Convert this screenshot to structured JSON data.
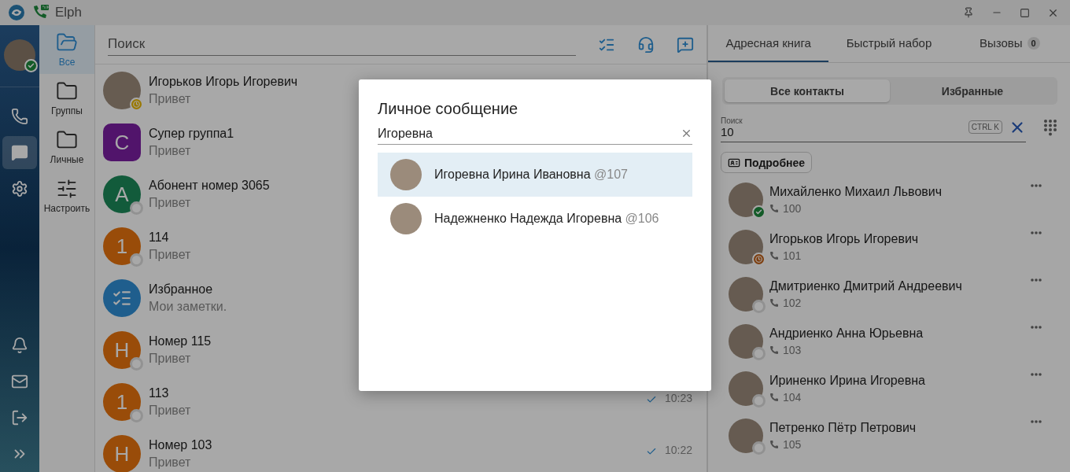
{
  "titlebar": {
    "app_name": "Elph"
  },
  "nav": {
    "user_badge": {
      "kind": "online"
    },
    "top_items": [
      {
        "kind": "phone",
        "selected": false
      },
      {
        "kind": "chat",
        "selected": true
      },
      {
        "kind": "settings",
        "selected": false
      }
    ],
    "bottom_items": [
      {
        "kind": "bell",
        "selected": false
      },
      {
        "kind": "mail",
        "selected": false
      },
      {
        "kind": "logout",
        "selected": false
      },
      {
        "kind": "expand",
        "selected": false
      }
    ]
  },
  "folders": [
    {
      "kind": "all",
      "label": "Все",
      "selected": true
    },
    {
      "kind": "folder",
      "label": "Группы",
      "selected": false
    },
    {
      "kind": "folder",
      "label": "Личные",
      "selected": false
    },
    {
      "kind": "settings",
      "label": "Настроить",
      "selected": false
    }
  ],
  "chat_list": {
    "search": {
      "placeholder": "Поиск"
    },
    "chats": [
      {
        "name": "Игорьков Игорь Игоревич",
        "preview": "Привет",
        "avatar": {
          "kind": "photo"
        },
        "badge": {
          "kind": "away"
        }
      },
      {
        "name": "Супер группа1",
        "preview": "Привет",
        "avatar": {
          "kind": "group",
          "letter": "С",
          "color": "#51146b"
        }
      },
      {
        "name": "Абонент номер 3065",
        "preview": "Привет",
        "avatar": {
          "kind": "letter",
          "letter": "А",
          "color": "#125b3b"
        },
        "badge": {
          "kind": "offline"
        }
      },
      {
        "name": "114",
        "preview": "Привет",
        "avatar": {
          "kind": "letter",
          "letter": "1",
          "color": "#994c09"
        },
        "badge": {
          "kind": "offline"
        }
      },
      {
        "name": "Избранное",
        "preview": "Мои заметки.",
        "avatar": {
          "kind": "notes",
          "color": "#1f5e8d"
        }
      },
      {
        "name": "Номер 115",
        "preview": "Привет",
        "avatar": {
          "kind": "letter",
          "letter": "Н",
          "color": "#994c09"
        },
        "badge": {
          "kind": "offline"
        }
      },
      {
        "name": "113",
        "preview": "Привет",
        "avatar": {
          "kind": "letter",
          "letter": "1",
          "color": "#994c09"
        },
        "badge": {
          "kind": "offline"
        },
        "time": "10:23"
      },
      {
        "name": "Номер 103",
        "preview": "Привет",
        "avatar": {
          "kind": "letter",
          "letter": "Н",
          "color": "#994c09"
        },
        "time": "10:22"
      }
    ]
  },
  "right_panel": {
    "tabs": [
      {
        "label": "Адресная книга",
        "selected": true
      },
      {
        "label": "Быстрый набор",
        "selected": false
      },
      {
        "label": "Вызовы",
        "badge": "0",
        "selected": false
      }
    ],
    "segments": [
      {
        "label": "Все контакты",
        "selected": true
      },
      {
        "label": "Избранные",
        "selected": false
      }
    ],
    "search": {
      "label": "Поиск",
      "value": "10",
      "shortcut": "CTRL K"
    },
    "details_button": "Подробнее",
    "contacts": [
      {
        "name": "Михайленко Михаил Львович",
        "number": "100",
        "badge": {
          "kind": "online"
        }
      },
      {
        "name": "Игорьков Игорь Игоревич",
        "number": "101",
        "badge": {
          "kind": "away"
        }
      },
      {
        "name": "Дмитриенко Дмитрий Андреевич",
        "number": "102",
        "badge": {
          "kind": "offline"
        }
      },
      {
        "name": "Андриенко Анна Юрьевна",
        "number": "103",
        "badge": {
          "kind": "offline"
        }
      },
      {
        "name": "Ириненко Ирина Игоревна",
        "number": "104",
        "badge": {
          "kind": "offline"
        }
      },
      {
        "name": "Петренко Пётр Петрович",
        "number": "105",
        "badge": {
          "kind": "offline"
        }
      }
    ]
  },
  "dialog": {
    "title": "Личное сообщение",
    "search": {
      "value": "Игоревна"
    },
    "results": [
      {
        "name": "Игоревна Ирина Ивановна",
        "handle": "@107",
        "selected": true
      },
      {
        "name": "Надежненко Надежда Игоревна",
        "handle": "@106",
        "selected": false
      }
    ]
  }
}
